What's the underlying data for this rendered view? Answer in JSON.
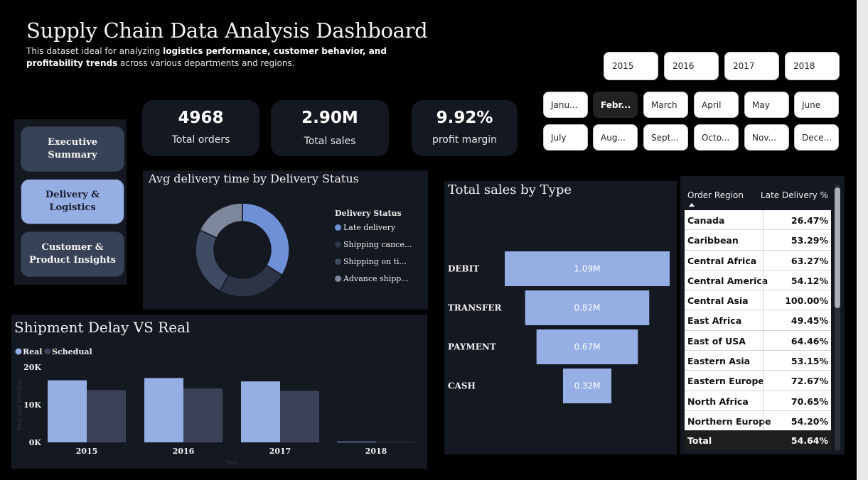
{
  "header": {
    "title": "Supply Chain Data Analysis Dashboard",
    "subtitle_pre": "This dataset ideal for analyzing ",
    "subtitle_bold": "logistics performance, customer behavior, and profitability trends",
    "subtitle_post": " across various departments and regions."
  },
  "kpis": [
    {
      "value": "4968",
      "label": "Total orders"
    },
    {
      "value": "2.90M",
      "label": "Total sales"
    },
    {
      "value": "9.92%",
      "label": "profit margin"
    }
  ],
  "nav": {
    "items": [
      {
        "label": "Executive Summary",
        "active": false
      },
      {
        "label": "Delivery & Logistics",
        "active": true
      },
      {
        "label": "Customer & Product Insights",
        "active": false
      }
    ]
  },
  "filters": {
    "years": [
      "2015",
      "2016",
      "2017",
      "2018"
    ],
    "months": [
      "Janu...",
      "Febr...",
      "March",
      "April",
      "May",
      "June",
      "July",
      "Aug...",
      "Sept...",
      "Octo...",
      "Nov...",
      "Dece..."
    ],
    "selected_month": "Febr..."
  },
  "colors": {
    "accent_light": "#95aee4",
    "accent_mid": "#6f8fd6",
    "accent_dark": "#3a4257",
    "panel": "#141820"
  },
  "donut": {
    "title": "Avg delivery time by Delivery Status",
    "legend_title": "Delivery Status",
    "legend": [
      {
        "label": "Late delivery",
        "color": "#6f8fd6"
      },
      {
        "label": "Shipping cance...",
        "color": "#2d3447"
      },
      {
        "label": "Shipping on ti...",
        "color": "#3f4a63"
      },
      {
        "label": "Advance shipp...",
        "color": "#7e889c"
      }
    ]
  },
  "funnel": {
    "title": "Total sales by Type"
  },
  "table": {
    "col1": "Order Region",
    "col2": "Late Delivery %",
    "rows": [
      {
        "region": "Canada",
        "pct": "26.47%"
      },
      {
        "region": "Caribbean",
        "pct": "53.29%"
      },
      {
        "region": "Central Africa",
        "pct": "63.27%"
      },
      {
        "region": "Central America",
        "pct": "54.12%"
      },
      {
        "region": "Central Asia",
        "pct": "100.00%"
      },
      {
        "region": "East Africa",
        "pct": "49.45%"
      },
      {
        "region": "East of USA",
        "pct": "64.46%"
      },
      {
        "region": "Eastern Asia",
        "pct": "53.15%"
      },
      {
        "region": "Eastern Europe",
        "pct": "72.67%"
      },
      {
        "region": "North Africa",
        "pct": "70.65%"
      },
      {
        "region": "Northern Europe",
        "pct": "54.20%"
      }
    ],
    "total_label": "Total",
    "total_value": "54.64%"
  },
  "chart_data": [
    {
      "type": "pie",
      "title": "Avg delivery time by Delivery Status",
      "legend_title": "Delivery Status",
      "categories": [
        "Late delivery",
        "Shipping cance...",
        "Shipping on ti...",
        "Advance shipp..."
      ],
      "values": [
        34,
        24,
        24,
        18
      ],
      "donut": true
    },
    {
      "type": "bar",
      "subtype": "funnel",
      "title": "Total sales by Type",
      "categories": [
        "DEBIT",
        "TRANSFER",
        "PAYMENT",
        "CASH"
      ],
      "values": [
        1.09,
        0.82,
        0.67,
        0.32
      ],
      "value_labels": [
        "1.09M",
        "0.82M",
        "0.67M",
        "0.32M"
      ]
    },
    {
      "type": "bar",
      "title": "Shipment Delay VS Real",
      "categories": [
        "2015",
        "2016",
        "2017",
        "2018"
      ],
      "series": [
        {
          "name": "Real",
          "color": "#95aee4",
          "values": [
            16500,
            17100,
            16200,
            200
          ]
        },
        {
          "name": "Schedual",
          "color": "#3a4257",
          "values": [
            13900,
            14300,
            13700,
            60
          ]
        }
      ],
      "yticks": [
        "0K",
        "10K",
        "20K"
      ],
      "ylim": [
        0,
        20000
      ],
      "xlabel": "Year",
      "ylabel": "Real and Schedual",
      "legend_position": "top-left"
    }
  ]
}
